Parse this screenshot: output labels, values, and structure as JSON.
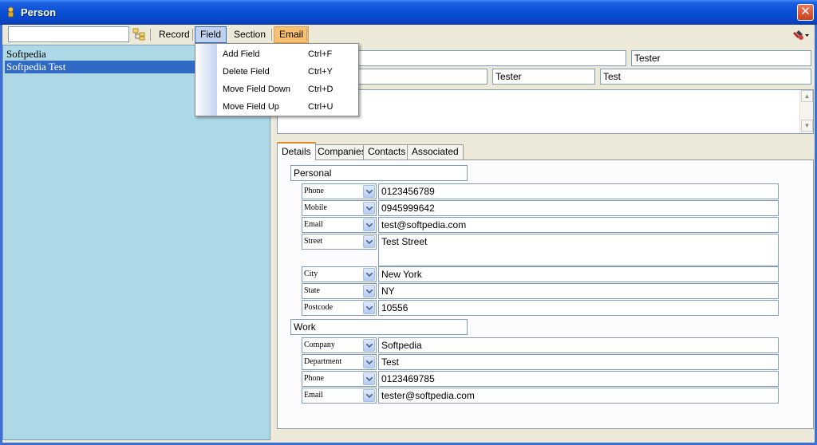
{
  "window": {
    "title": "Person",
    "close_glyph": "✕"
  },
  "toolbar": {
    "search_value": "",
    "menus": {
      "record": "Record",
      "field": "Field",
      "section": "Section",
      "email": "Email"
    }
  },
  "contacts": [
    {
      "name": "Softpedia",
      "selected": false
    },
    {
      "name": "Softpedia Test",
      "selected": true
    }
  ],
  "field_menu": [
    {
      "label": "Add Field",
      "shortcut": "Ctrl+F"
    },
    {
      "label": "Delete Field",
      "shortcut": "Ctrl+Y"
    },
    {
      "label": "Move Field Down",
      "shortcut": "Ctrl+D"
    },
    {
      "label": "Move Field Up",
      "shortcut": "Ctrl+U"
    }
  ],
  "header_fields": {
    "row1_a": "",
    "row1_b": "Tester",
    "row2_a": "",
    "row2_b": "Tester",
    "row2_c": "Test",
    "notes": ""
  },
  "tabs": [
    "Details",
    "Companies",
    "Contacts",
    "Associated"
  ],
  "details": {
    "personal": {
      "section": "Personal",
      "fields": [
        {
          "label": "Phone",
          "value": "0123456789"
        },
        {
          "label": "Mobile",
          "value": "0945999642"
        },
        {
          "label": "Email",
          "value": "test@softpedia.com"
        },
        {
          "label": "Street",
          "value": "Test Street"
        },
        {
          "label": "City",
          "value": "New York"
        },
        {
          "label": "State",
          "value": "NY"
        },
        {
          "label": "Postcode",
          "value": "10556"
        }
      ]
    },
    "work": {
      "section": "Work",
      "fields": [
        {
          "label": "Company",
          "value": "Softpedia"
        },
        {
          "label": "Department",
          "value": "Test"
        },
        {
          "label": "Phone",
          "value": "0123469785"
        },
        {
          "label": "Email",
          "value": "tester@softpedia.com"
        }
      ]
    }
  }
}
